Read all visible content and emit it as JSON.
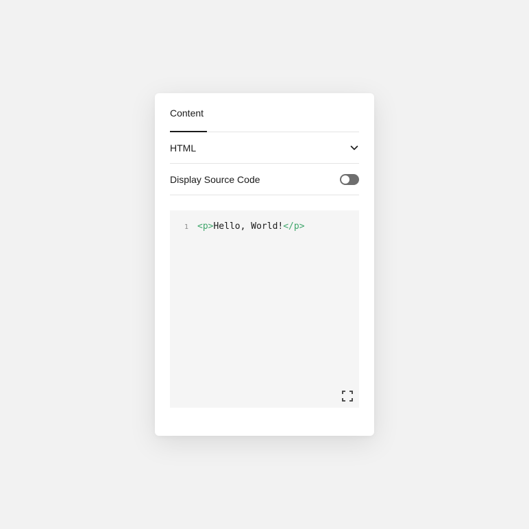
{
  "panel": {
    "tabs": [
      {
        "label": "Content",
        "active": true
      }
    ],
    "language_select": {
      "selected": "HTML"
    },
    "source_toggle": {
      "label": "Display Source Code",
      "on": false
    },
    "editor": {
      "lines": [
        {
          "number": "1",
          "open_tag": "<p>",
          "text": "Hello, World!",
          "close_tag": "</p>"
        }
      ]
    }
  },
  "colors": {
    "background": "#f2f2f2",
    "panel": "#ffffff",
    "editor_bg": "#f5f5f5",
    "tag_color": "#3fa66b",
    "toggle_track": "#6e6e6e"
  },
  "icons": {
    "select": "chevron-down-icon",
    "editor": "expand-icon"
  }
}
